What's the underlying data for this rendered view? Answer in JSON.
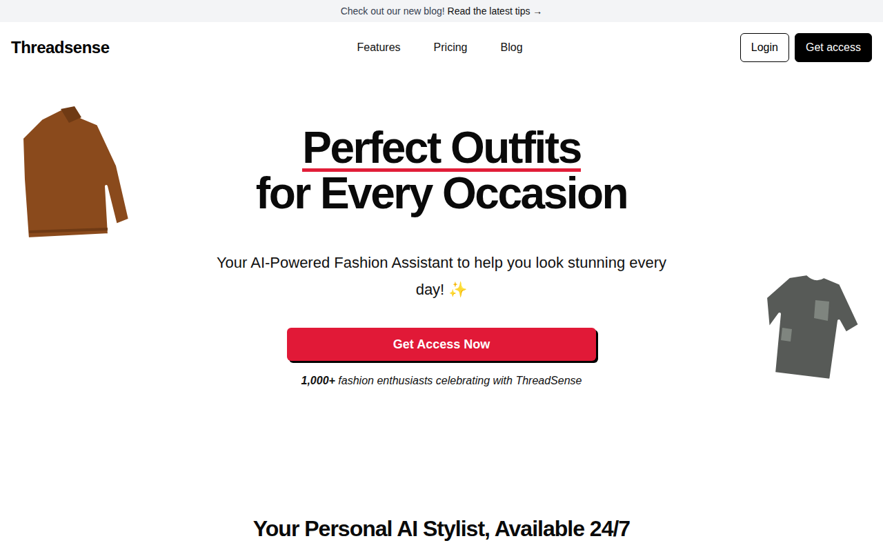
{
  "banner": {
    "text": "Check out our new blog!",
    "link": "Read the latest tips →"
  },
  "header": {
    "logo": "Threadsense",
    "nav": [
      "Features",
      "Pricing",
      "Blog"
    ],
    "login": "Login",
    "get_access": "Get access"
  },
  "hero": {
    "title_highlight": "Perfect Outfits",
    "title_rest": "for Every Occasion",
    "subtitle": "Your AI-Powered Fashion Assistant to help you look stunning every day! ✨",
    "cta": "Get Access Now",
    "proof_count": "1,000+",
    "proof_text": "fashion enthusiasts celebrating with ThreadSense"
  },
  "section": {
    "title": "Your Personal AI Stylist, Available 24/7"
  }
}
